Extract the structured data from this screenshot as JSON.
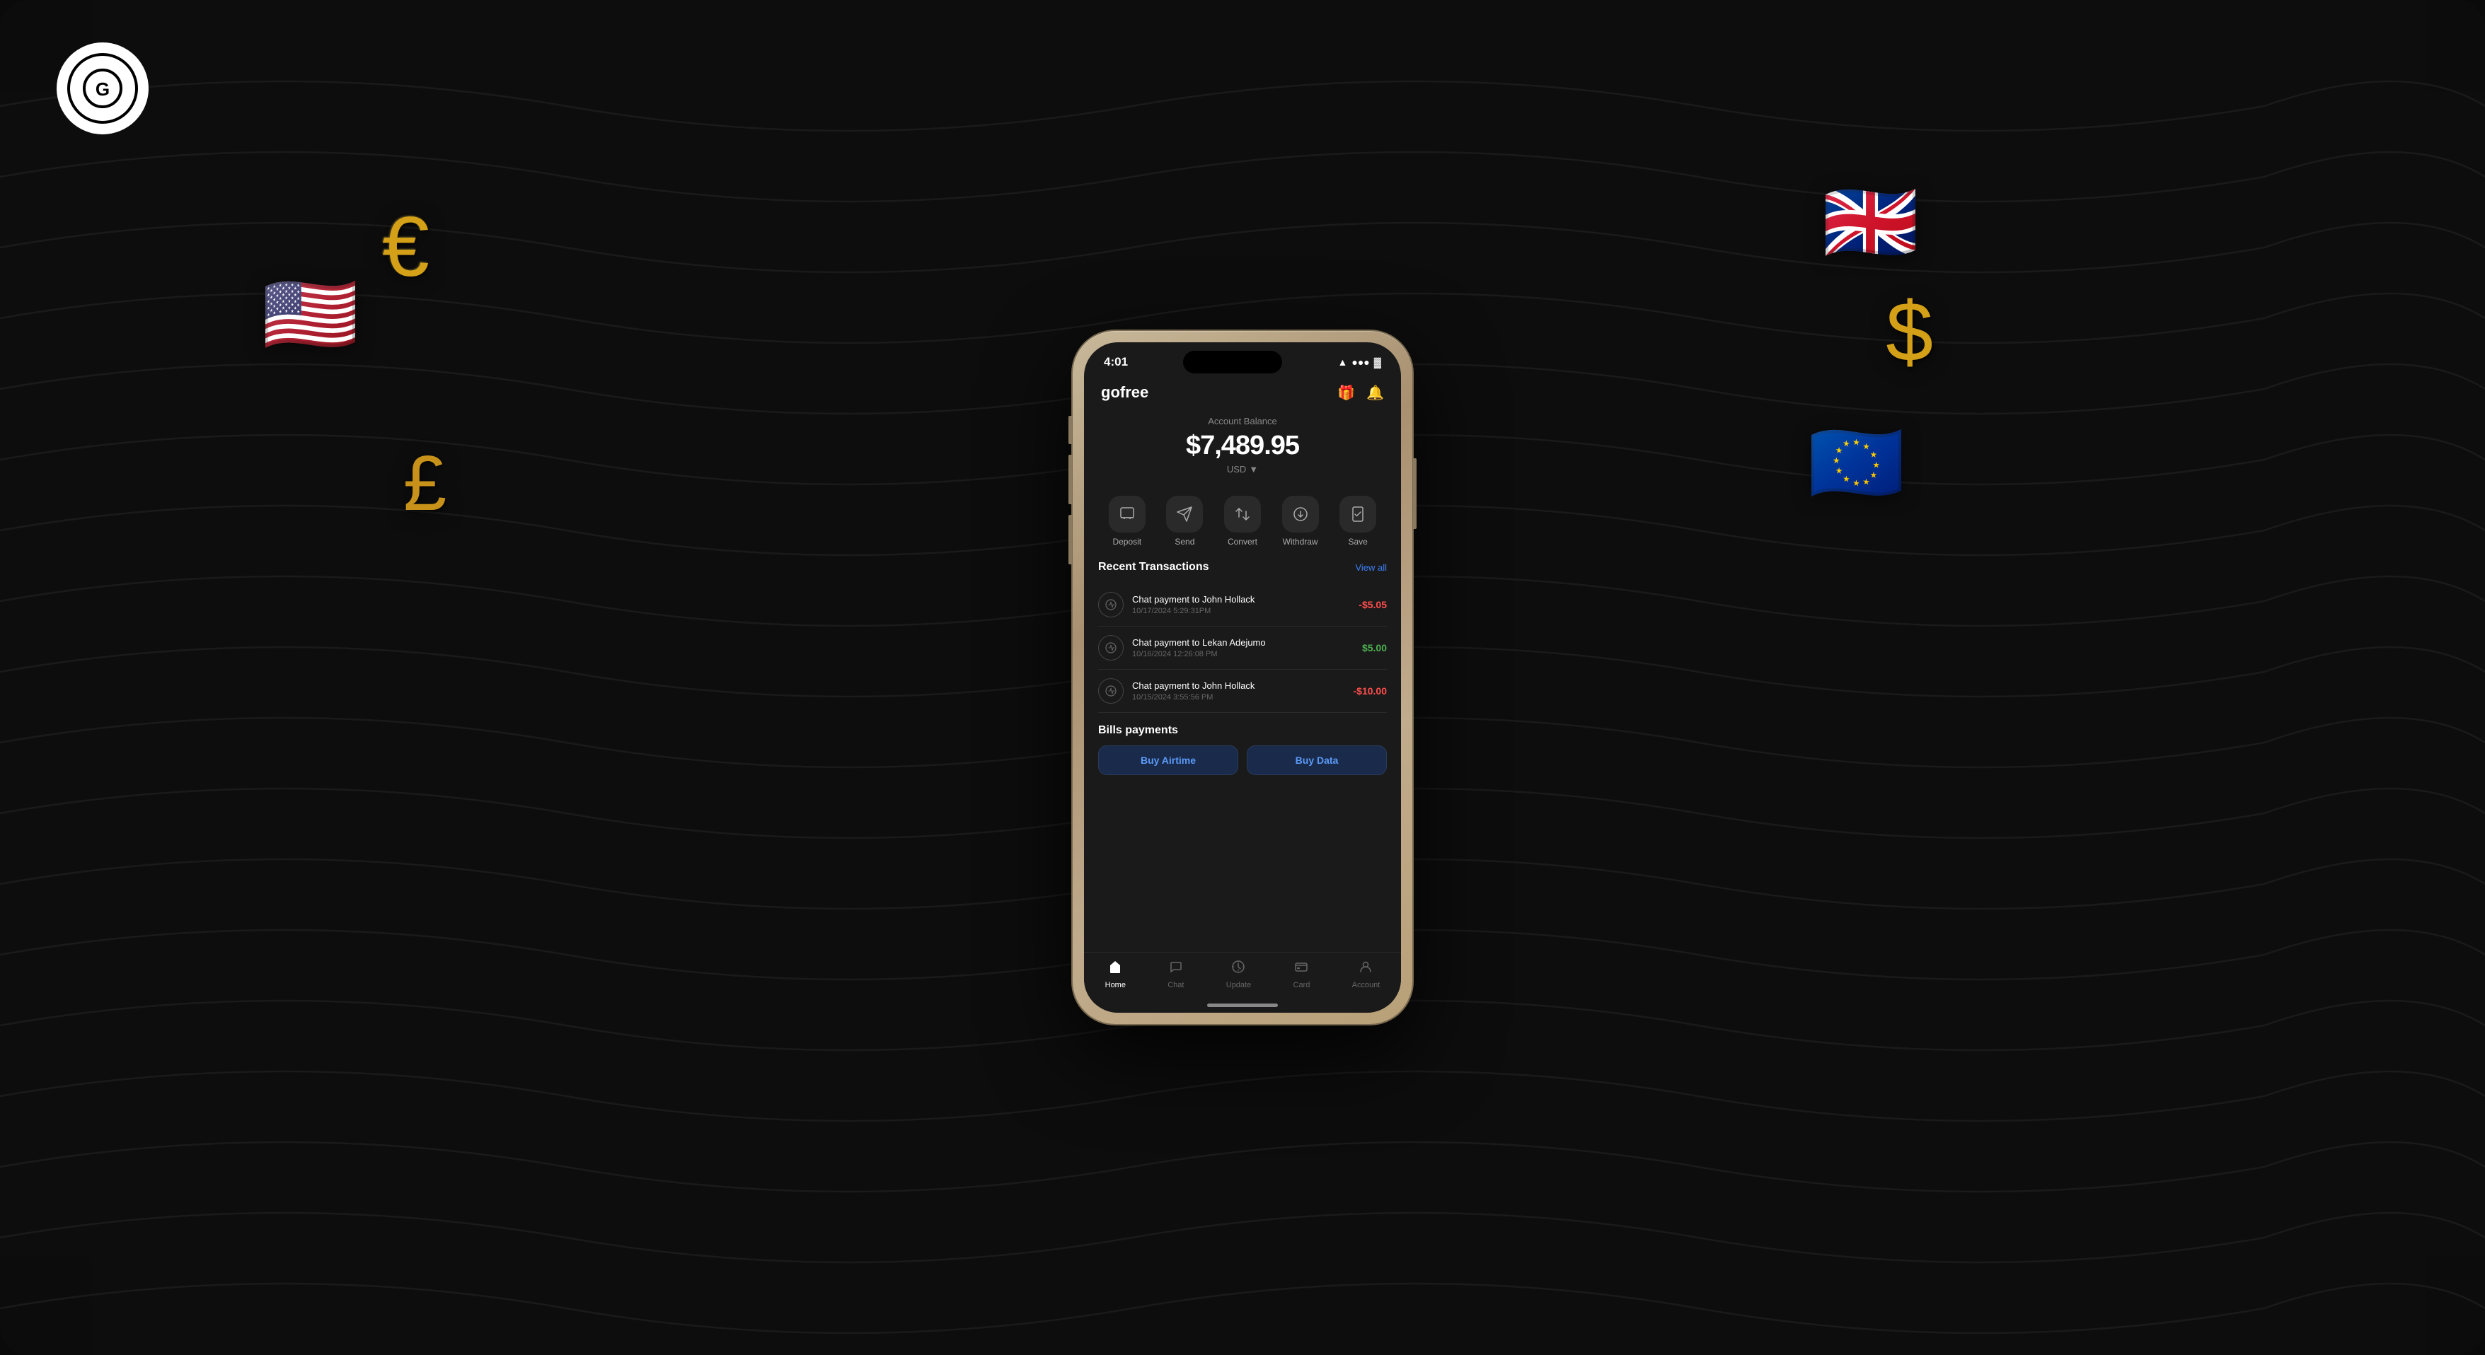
{
  "app": {
    "title": "gofree",
    "status_time": "4:01",
    "balance_label": "Account Balance",
    "balance_amount": "$7,489.95",
    "balance_currency": "USD",
    "actions": [
      {
        "id": "deposit",
        "label": "Deposit",
        "icon": "📥"
      },
      {
        "id": "send",
        "label": "Send",
        "icon": "📤"
      },
      {
        "id": "convert",
        "label": "Convert",
        "icon": "🔄"
      },
      {
        "id": "withdraw",
        "label": "Withdraw",
        "icon": "💳"
      },
      {
        "id": "save",
        "label": "Save",
        "icon": "🔒"
      }
    ],
    "recent_transactions_title": "Recent Transactions",
    "view_all_label": "View all",
    "transactions": [
      {
        "id": 1,
        "name": "Chat payment to John Hollack",
        "date": "10/17/2024 5:29:31PM",
        "amount": "-$5.05",
        "type": "negative"
      },
      {
        "id": 2,
        "name": "Chat payment to Lekan Adejumo",
        "date": "10/16/2024 12:26:08 PM",
        "amount": "$5.00",
        "type": "positive"
      },
      {
        "id": 3,
        "name": "Chat payment to John Hollack",
        "date": "10/15/2024 3:55:56 PM",
        "amount": "-$10.00",
        "type": "negative"
      }
    ],
    "bills_title": "Bills payments",
    "buy_airtime_label": "Buy Airtime",
    "buy_data_label": "Buy Data",
    "nav": [
      {
        "id": "home",
        "label": "Home",
        "icon": "🏠",
        "active": true
      },
      {
        "id": "chat",
        "label": "Chat",
        "icon": "💬",
        "active": false
      },
      {
        "id": "update",
        "label": "Update",
        "icon": "➕",
        "active": false
      },
      {
        "id": "card",
        "label": "Card",
        "icon": "💳",
        "active": false
      },
      {
        "id": "account",
        "label": "Account",
        "icon": "👤",
        "active": false
      }
    ]
  },
  "floaters": {
    "euro": "€",
    "pound": "£",
    "dollar": "$",
    "us_flag": "🇺🇸",
    "uk_flag": "🇬🇧",
    "eu_flag": "🇪🇺"
  },
  "logo": {
    "symbol": "G"
  }
}
